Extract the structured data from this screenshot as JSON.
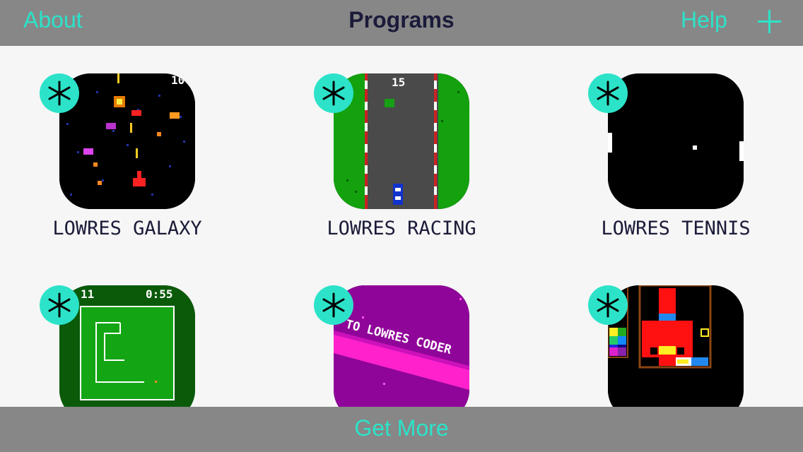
{
  "navbar": {
    "about_label": "About",
    "title": "Programs",
    "help_label": "Help",
    "add_icon": "plus-icon"
  },
  "programs": [
    {
      "name": "LOWRES GALAXY",
      "score": "10"
    },
    {
      "name": "LOWRES RACING",
      "score": "15"
    },
    {
      "name": "LOWRES TENNIS"
    },
    {
      "name": "",
      "score": "11",
      "time": "0:55"
    },
    {
      "name": "",
      "scroll_text": "TO LOWRES CODER"
    },
    {
      "name": ""
    }
  ],
  "badge_icon": "asterisk-icon",
  "bottombar": {
    "get_more_label": "Get More"
  },
  "colors": {
    "accent": "#2ce3c9",
    "bar": "#878787",
    "background": "#f6f6f6",
    "title": "#1b1b3a"
  }
}
